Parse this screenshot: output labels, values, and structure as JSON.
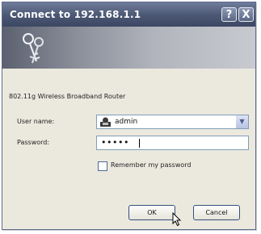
{
  "window": {
    "title": "Connect to 192.168.1.1",
    "help_button": "?",
    "close_button": "X"
  },
  "dialog": {
    "description": "802.11g Wireless Broadband Router",
    "username_label": "User name:",
    "username_value": "admin",
    "password_label": "Password:",
    "password_value": "•••••",
    "remember_label": "Remember my password",
    "remember_checked": false
  },
  "buttons": {
    "ok": "OK",
    "cancel": "Cancel"
  },
  "icons": [
    "keys-icon",
    "user-icon",
    "chevron-down-icon",
    "mouse-cursor-icon"
  ]
}
